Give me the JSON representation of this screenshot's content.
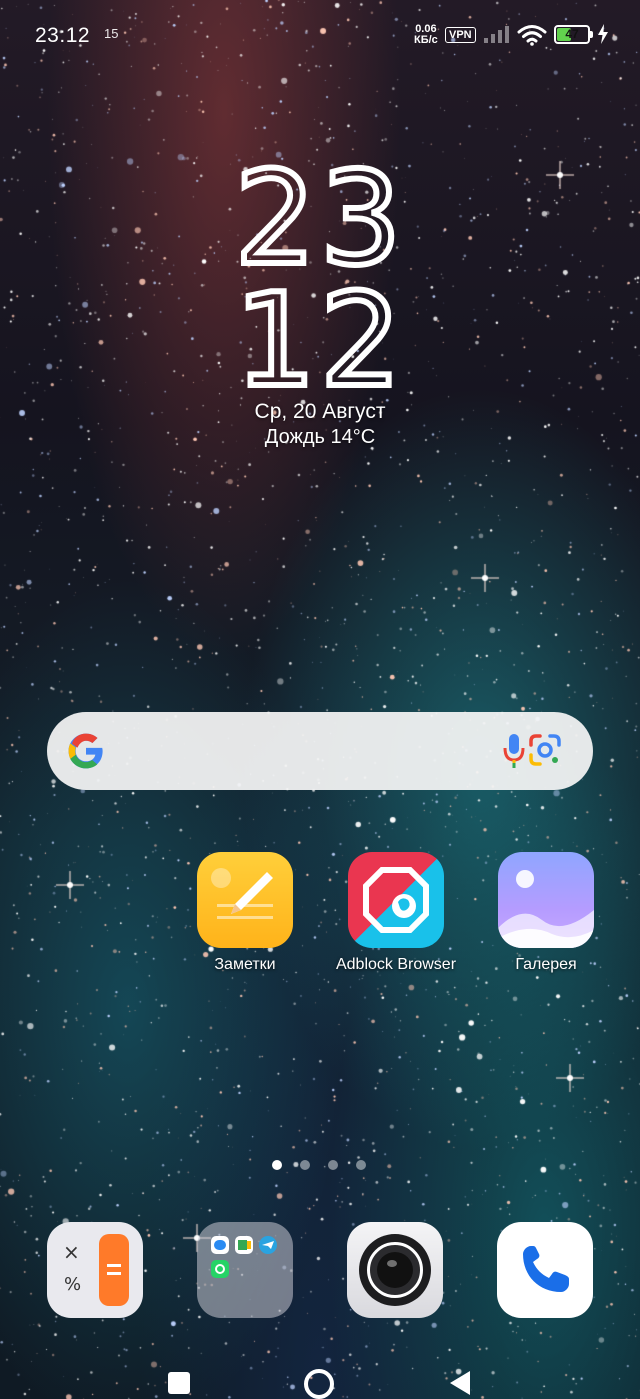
{
  "status_bar": {
    "time": "23:12",
    "notification_count": "15",
    "net_speed_value": "0.06",
    "net_speed_unit": "КБ/с",
    "vpn_label": "VPN",
    "battery_level": "47",
    "battery_fraction": 0.47,
    "battery_color": "#62d14e",
    "charging": true
  },
  "clock": {
    "hours": "23",
    "minutes": "12",
    "date": "Ср, 20 Август",
    "weather": "Дождь  14°C"
  },
  "search_bar": {
    "logo_icon": "google-g-icon",
    "voice_icon": "microphone-icon",
    "lens_icon": "google-lens-icon"
  },
  "apps": [
    {
      "label": "Заметки",
      "icon": "notes-icon"
    },
    {
      "label": "Adblock Browser",
      "icon": "adblock-icon"
    },
    {
      "label": "Галерея",
      "icon": "gallery-icon"
    }
  ],
  "page_indicator": {
    "pages": 4,
    "active_index": 0
  },
  "dock": [
    {
      "name": "calculator-icon"
    },
    {
      "name": "messengers-folder-icon"
    },
    {
      "name": "camera-icon"
    },
    {
      "name": "phone-icon"
    }
  ],
  "nav_bar": {
    "recent_icon": "recent-apps-icon",
    "home_icon": "home-icon",
    "back_icon": "back-icon"
  }
}
